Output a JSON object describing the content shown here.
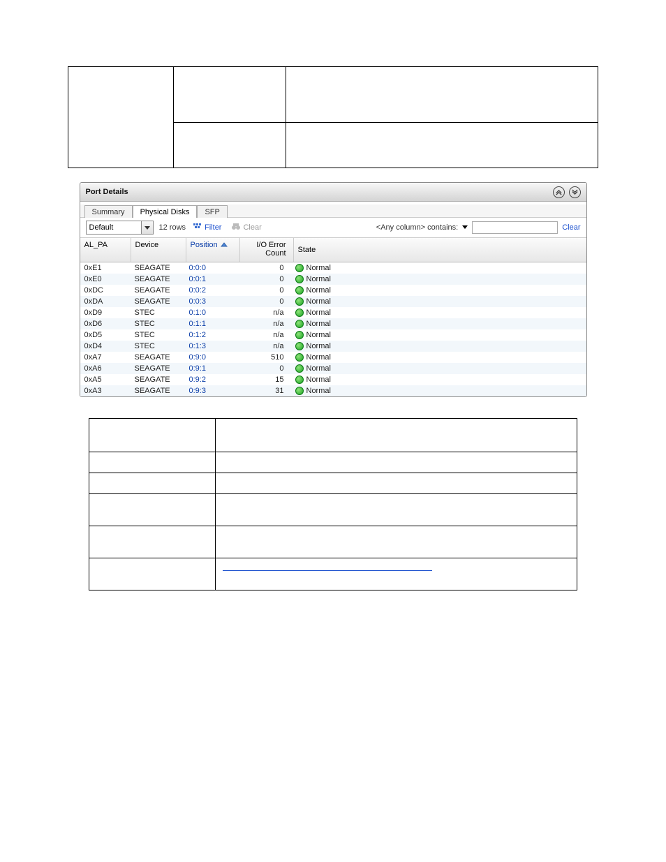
{
  "doc": {
    "table1": {
      "r0c0": "",
      "r0c1": "",
      "r0c2": "",
      "r1c0": "",
      "r1c1": ""
    },
    "fig_caption": "",
    "table2": {
      "r0c0": "",
      "r0c1": "",
      "r1c0": "",
      "r1c1": "",
      "r2c0": "",
      "r2c1": "",
      "r3c0": "",
      "r3c1": "",
      "r4c0": "",
      "r4c1": "",
      "r5c0": "",
      "r5c1": ""
    }
  },
  "panel": {
    "title": "Port Details",
    "tabs": [
      "Summary",
      "Physical Disks",
      "SFP"
    ],
    "active_tab": 1,
    "toolbar": {
      "preset_value": "Default",
      "row_count_label": "12 rows",
      "filter_label": "Filter",
      "clear_label": "Clear",
      "search_any_label": "<Any column> contains:",
      "search_value": "",
      "clear_link": "Clear"
    },
    "columns": [
      "AL_PA",
      "Device",
      "Position",
      "I/O Error Count",
      "State"
    ],
    "rows": [
      {
        "alpa": "0xE1",
        "device": "SEAGATE",
        "position": "0:0:0",
        "io": "0",
        "state": "Normal"
      },
      {
        "alpa": "0xE0",
        "device": "SEAGATE",
        "position": "0:0:1",
        "io": "0",
        "state": "Normal"
      },
      {
        "alpa": "0xDC",
        "device": "SEAGATE",
        "position": "0:0:2",
        "io": "0",
        "state": "Normal"
      },
      {
        "alpa": "0xDA",
        "device": "SEAGATE",
        "position": "0:0:3",
        "io": "0",
        "state": "Normal"
      },
      {
        "alpa": "0xD9",
        "device": "STEC",
        "position": "0:1:0",
        "io": "n/a",
        "state": "Normal"
      },
      {
        "alpa": "0xD6",
        "device": "STEC",
        "position": "0:1:1",
        "io": "n/a",
        "state": "Normal"
      },
      {
        "alpa": "0xD5",
        "device": "STEC",
        "position": "0:1:2",
        "io": "n/a",
        "state": "Normal"
      },
      {
        "alpa": "0xD4",
        "device": "STEC",
        "position": "0:1:3",
        "io": "n/a",
        "state": "Normal"
      },
      {
        "alpa": "0xA7",
        "device": "SEAGATE",
        "position": "0:9:0",
        "io": "510",
        "state": "Normal"
      },
      {
        "alpa": "0xA6",
        "device": "SEAGATE",
        "position": "0:9:1",
        "io": "0",
        "state": "Normal"
      },
      {
        "alpa": "0xA5",
        "device": "SEAGATE",
        "position": "0:9:2",
        "io": "15",
        "state": "Normal"
      },
      {
        "alpa": "0xA3",
        "device": "SEAGATE",
        "position": "0:9:3",
        "io": "31",
        "state": "Normal"
      }
    ]
  }
}
